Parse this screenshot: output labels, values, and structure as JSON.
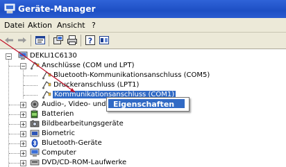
{
  "window": {
    "title": "Geräte-Manager"
  },
  "menu": [
    "Datei",
    "Aktion",
    "Ansicht",
    "?"
  ],
  "toolbar": [
    "back-icon",
    "forward-icon",
    "properties-icon",
    "scan-icon",
    "print-icon",
    "help-icon",
    "view-icon"
  ],
  "tree": {
    "root": "DEKLI1C6130",
    "ports_group": "Anschlüsse (COM und LPT)",
    "ports": [
      "Bluetooth-Kommunikationsanschluss (COM5)",
      "Druckeranschluss (LPT1)",
      "Kommunikationsanschluss (COM1)"
    ],
    "categories": [
      "Audio-, Video- und G",
      "Batterien",
      "Bildbearbeitungsgeräte",
      "Biometric",
      "Bluetooth-Geräte",
      "Computer",
      "DVD/CD-ROM-Laufwerke"
    ]
  },
  "context_menu": {
    "item": "Eigenschaften"
  },
  "colors": {
    "titlebar": "#1d4fc4",
    "selection": "#316ac5",
    "chrome": "#ece9d8"
  }
}
